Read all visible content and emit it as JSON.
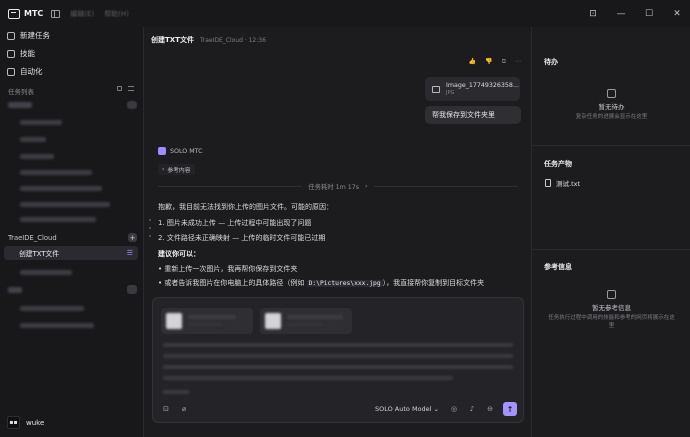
{
  "app": {
    "name": "MTC",
    "menu": [
      "编辑(E)",
      "帮助(H)"
    ]
  },
  "window_controls": [
    "⊡",
    "—",
    "☐",
    "✕"
  ],
  "sidebar": {
    "nav": [
      {
        "label": "新建任务",
        "icon": "new-task-icon"
      },
      {
        "label": "技能",
        "icon": "skills-icon"
      },
      {
        "label": "自动化",
        "icon": "automation-icon"
      }
    ],
    "task_list_label": "任务列表",
    "group_trae": "TraeIDE_Cloud",
    "active_task": "创建TXT文件",
    "plus_symbol": "+",
    "user": {
      "name": "wuke",
      "avatar_text": "▪▪"
    }
  },
  "main": {
    "title": "创建TXT文件",
    "subtitle": "TraeIDE_Cloud · 12:36",
    "file_card": {
      "name": "Image_17749326358...",
      "type": "JPG"
    },
    "user_message": "帮我保存到文件夹里",
    "agent_name": "SOLO MTC",
    "ref_chip": "参考内容",
    "duration": "任务耗时 1m 17s",
    "response": {
      "intro": "抱歉，我目前无法找到你上传的图片文件。可能的原因：",
      "reasons": [
        "1. 图片未成功上传 — 上传过程中可能出现了问题",
        "2. 文件路径未正确映射 — 上传的临时文件可能已过期"
      ],
      "suggest_title": "建议你可以：",
      "suggest_1": "重新上传一次图片，我再帮你保存到文件夹",
      "suggest_2_pre": "或者告诉我图片在你电脑上的具体路径（例如 ",
      "suggest_2_code": "D:\\Pictures\\xxx.jpg",
      "suggest_2_post": "），我直接帮你复制到目标文件夹"
    },
    "composer": {
      "model": "SOLO Auto Model",
      "send_symbol": "↑"
    }
  },
  "right_panel": {
    "todo_title": "待办",
    "todo_empty_title": "暂无待办",
    "todo_empty_desc": "复杂任务的进展会显示在这里",
    "artifacts_title": "任务产物",
    "artifact_file": "测试.txt",
    "refs_title": "参考信息",
    "refs_empty_title": "暂无参考信息",
    "refs_empty_desc": "任务执行过程中调用的技能和参考的网页将展示在这里"
  }
}
